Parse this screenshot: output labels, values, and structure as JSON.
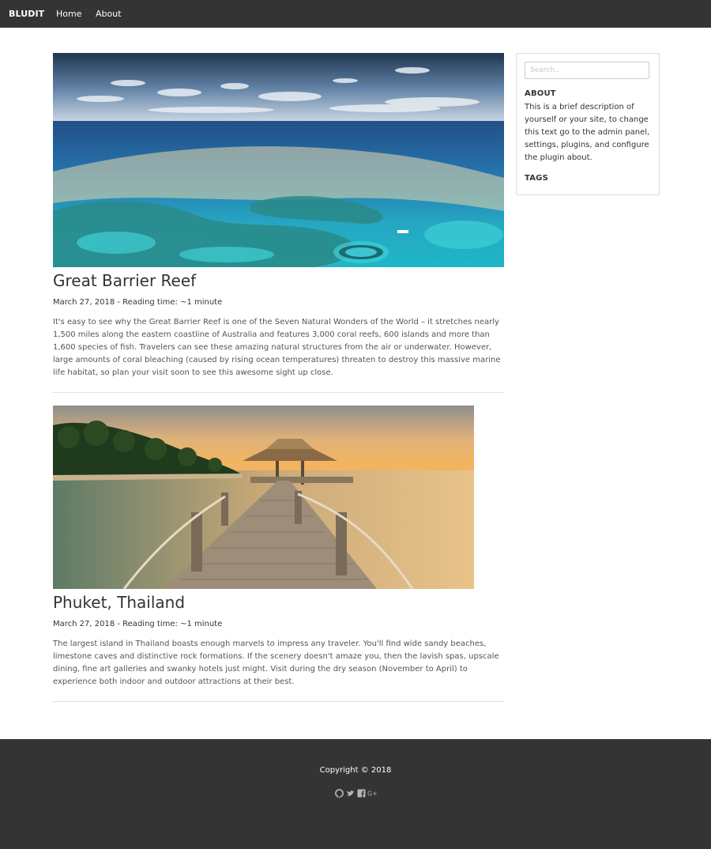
{
  "nav": {
    "brand": "BLUDIT",
    "links": [
      {
        "label": "Home"
      },
      {
        "label": "About"
      }
    ]
  },
  "posts": [
    {
      "title": "Great Barrier Reef",
      "meta": "March 27, 2018 - Reading time: ~1 minute",
      "body": "It's easy to see why the Great Barrier Reef is one of the Seven Natural Wonders of the World – it stretches nearly 1,500 miles along the eastern coastline of Australia and features 3,000 coral reefs, 600 islands and more than 1,600 species of fish. Travelers can see these amazing natural structures from the air or underwater. However, large amounts of coral bleaching (caused by rising ocean temperatures) threaten to destroy this massive marine life habitat, so plan your visit soon to see this awesome sight up close."
    },
    {
      "title": "Phuket, Thailand",
      "meta": "March 27, 2018 - Reading time: ~1 minute",
      "body": "The largest island in Thailand boasts enough marvels to impress any traveler. You'll find wide sandy beaches, limestone caves and distinctive rock formations. If the scenery doesn't amaze you, then the lavish spas, upscale dining, fine art galleries and swanky hotels just might. Visit during the dry season (November to April) to experience both indoor and outdoor attractions at their best."
    }
  ],
  "sidebar": {
    "search_placeholder": "Search...",
    "about_heading": "ABOUT",
    "about_text": "This is a brief description of yourself or your site, to change this text go to the admin panel, settings, plugins, and configure the plugin about.",
    "tags_heading": "TAGS"
  },
  "footer": {
    "copyright": "Copyright © 2018",
    "social_icons": [
      "github-icon",
      "twitter-icon",
      "facebook-icon",
      "google-plus-icon"
    ]
  },
  "colors": {
    "navbar_bg": "#343434",
    "footer_bg": "#343434",
    "text": "#333333"
  }
}
